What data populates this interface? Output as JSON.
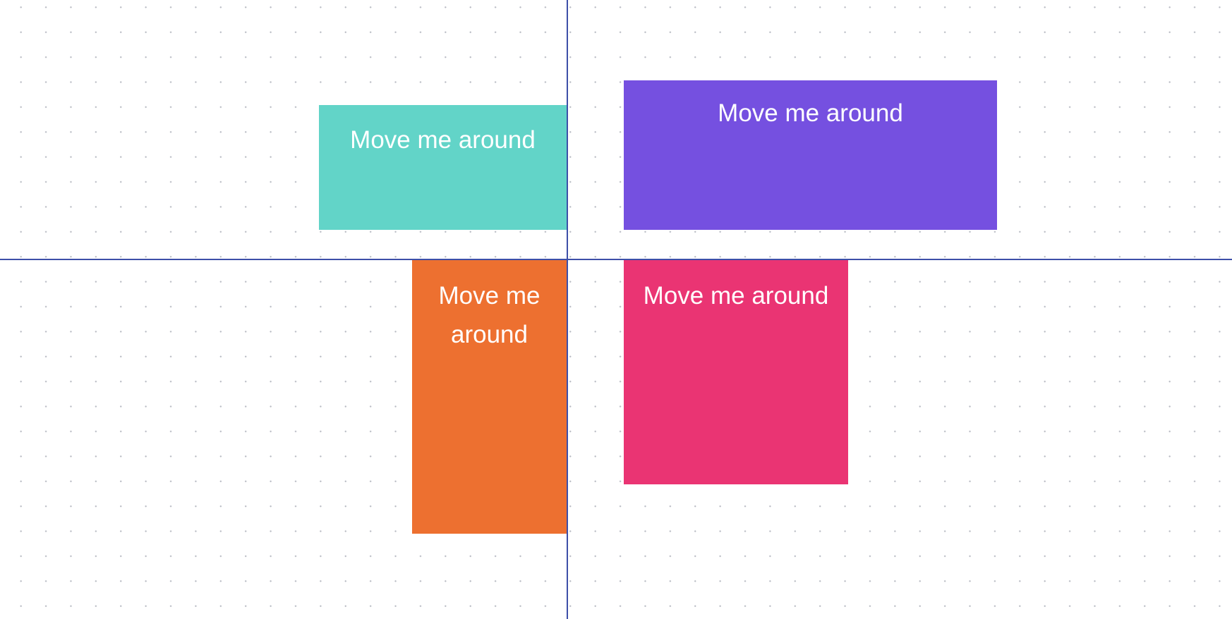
{
  "canvas": {
    "background": "#ffffff",
    "dot_color": "#b9bcc4",
    "guide_color": "#3d4fa8"
  },
  "boxes": [
    {
      "id": "teal",
      "label": "Move me around",
      "color": "#62d4c8"
    },
    {
      "id": "purple",
      "label": "Move me around",
      "color": "#7550e0"
    },
    {
      "id": "orange",
      "label": "Move me around",
      "color": "#ed7030"
    },
    {
      "id": "pink",
      "label": "Move me around",
      "color": "#ea3473"
    }
  ]
}
